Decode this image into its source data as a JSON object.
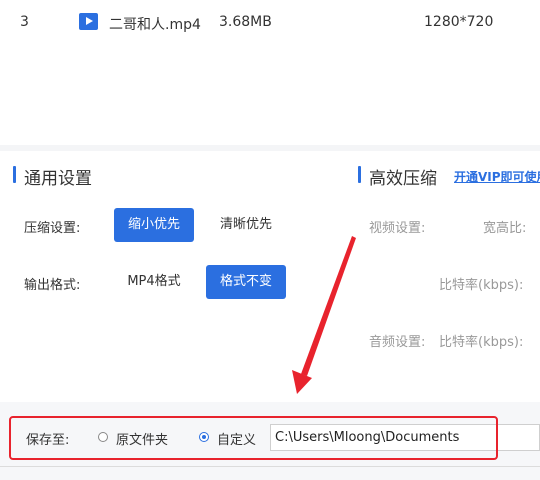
{
  "file_row": {
    "index": "3",
    "name": "二哥和人.mp4",
    "size": "3.68MB",
    "resolution": "1280*720"
  },
  "general": {
    "title": "通用设置",
    "compression_label": "压缩设置:",
    "compression_options": [
      "缩小优先",
      "清晰优先"
    ],
    "compression_selected": "缩小优先",
    "format_label": "输出格式:",
    "format_options": [
      "MP4格式",
      "格式不变"
    ],
    "format_selected": "格式不变"
  },
  "efficient": {
    "title": "高效压缩",
    "vip_link": "开通VIP即可使用",
    "video_settings": "视频设置:",
    "aspect_ratio": "宽高比:",
    "bitrate_video": "比特率(kbps):",
    "audio_settings": "音频设置:",
    "bitrate_audio": "比特率(kbps):"
  },
  "save": {
    "label": "保存至:",
    "option_original": "原文件夹",
    "option_custom": "自定义",
    "selected": "自定义",
    "path": "C:\\Users\\Mloong\\Documents"
  },
  "colors": {
    "accent": "#2b6fe0",
    "highlight_box": "#e8232d",
    "arrow": "#e8232d"
  }
}
